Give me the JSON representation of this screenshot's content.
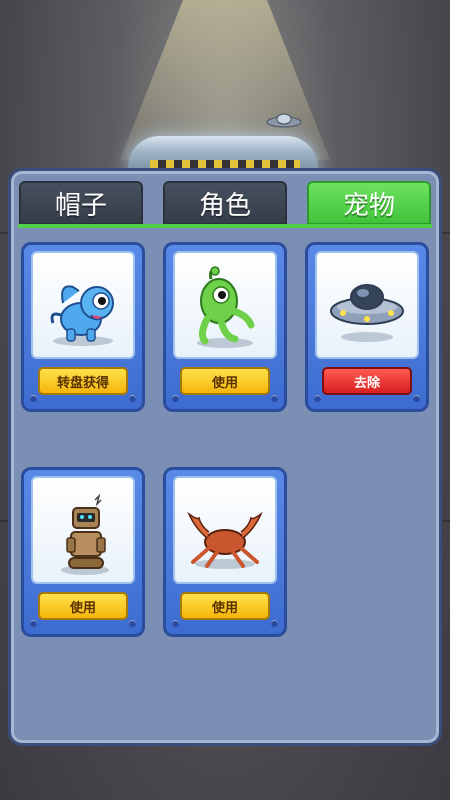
{
  "tabs": [
    {
      "label": "帽子",
      "active": false
    },
    {
      "label": "角色",
      "active": false
    },
    {
      "label": "宠物",
      "active": true
    }
  ],
  "colors": {
    "tab_active": "#4fd04a",
    "tab_inactive": "#3d4653",
    "panel": "#7b8fb5",
    "card": "#4a7ae0",
    "button_use": "#f9c626",
    "button_remove": "#e02a2a"
  },
  "pets": [
    {
      "icon": "blue-dog-pet-icon",
      "button": "转盘获得",
      "button_style": "yellow"
    },
    {
      "icon": "green-alien-pet-icon",
      "button": "使用",
      "button_style": "yellow"
    },
    {
      "icon": "ufo-pet-icon",
      "button": "去除",
      "button_style": "red"
    },
    {
      "icon": "robot-pet-icon",
      "button": "使用",
      "button_style": "yellow"
    },
    {
      "icon": "crab-pet-icon",
      "button": "使用",
      "button_style": "yellow"
    }
  ]
}
